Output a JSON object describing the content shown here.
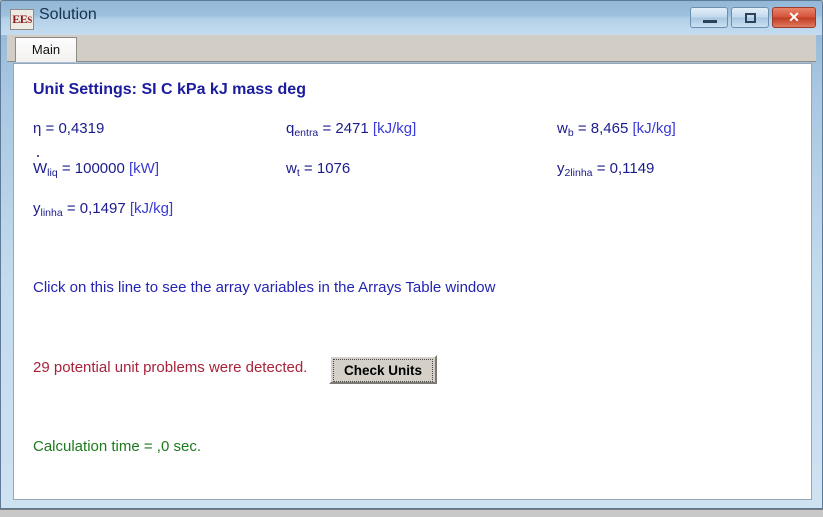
{
  "window": {
    "title": "Solution",
    "icon_label": "EES",
    "icon_letters": {
      "e1": "E",
      "e2": "E",
      "s": "S"
    },
    "controls": {
      "minimize_label": "–",
      "maximize_label": "□",
      "close_label": "✕"
    }
  },
  "tabs": [
    {
      "label": "Main",
      "active": true
    }
  ],
  "solution": {
    "unit_settings": "Unit Settings: SI C kPa kJ mass deg",
    "variables": [
      {
        "symbol": "η",
        "subscript": "",
        "overdot": false,
        "equals": "=",
        "value": "0,4319",
        "unit": "",
        "column": 1,
        "row": 1
      },
      {
        "symbol": "q",
        "subscript": "entra",
        "overdot": false,
        "equals": "=",
        "value": "2471",
        "unit": "[kJ/kg]",
        "column": 2,
        "row": 1
      },
      {
        "symbol": "w",
        "subscript": "b",
        "overdot": false,
        "equals": "=",
        "value": "8,465",
        "unit": "[kJ/kg]",
        "column": 3,
        "row": 1
      },
      {
        "symbol": "W",
        "subscript": "liq",
        "overdot": true,
        "equals": "=",
        "value": "100000",
        "unit": "[kW]",
        "column": 1,
        "row": 2
      },
      {
        "symbol": "w",
        "subscript": "t",
        "overdot": false,
        "equals": "=",
        "value": "1076",
        "unit": "",
        "column": 2,
        "row": 2
      },
      {
        "symbol": "y",
        "subscript": "2linha",
        "overdot": false,
        "equals": "=",
        "value": "0,1149",
        "unit": "",
        "column": 3,
        "row": 2
      },
      {
        "symbol": "y",
        "subscript": "linha",
        "overdot": false,
        "equals": "=",
        "value": "0,1497",
        "unit": "[kJ/kg]",
        "column": 1,
        "row": 3
      }
    ],
    "array_link": "Click on this line to see the array variables in the Arrays Table window",
    "unit_warning": "29 potential unit problems were detected.",
    "check_units_button": "Check Units",
    "calculation_time": "Calculation time = ,0 sec."
  },
  "colors": {
    "title_text": "#16314e",
    "heading_blue": "#1b1b9e",
    "variable_blue": "#1b1b8c",
    "unit_blue": "#3a3ad6",
    "link_blue": "#2424b4",
    "warning_red": "#a8223a",
    "success_green": "#1d7a1d",
    "close_button_red": "#bf3c22"
  }
}
